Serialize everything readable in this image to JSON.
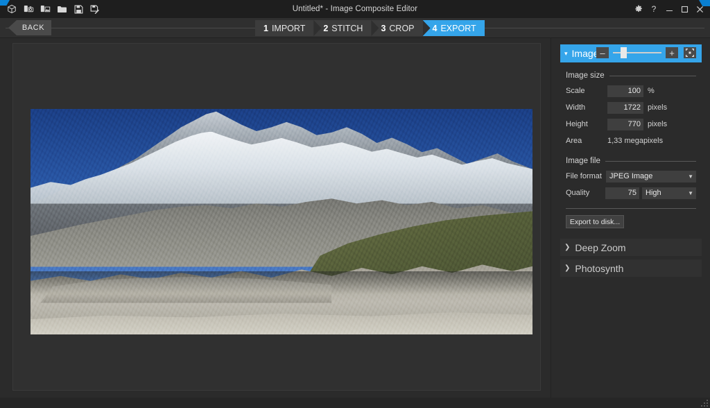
{
  "window": {
    "title": "Untitled* - Image Composite Editor",
    "toolbar_icons": [
      {
        "name": "app-cube-icon",
        "label": "Image Composite Editor"
      },
      {
        "name": "new-panorama-from-camera-icon",
        "label": "New panorama from camera"
      },
      {
        "name": "new-panorama-from-images-icon",
        "label": "New panorama from images"
      },
      {
        "name": "open-folder-icon",
        "label": "Open"
      },
      {
        "name": "save-icon",
        "label": "Save"
      },
      {
        "name": "save-as-icon",
        "label": "Save as"
      }
    ],
    "controls": [
      {
        "name": "settings-gear-icon",
        "label": "Settings"
      },
      {
        "name": "help-icon",
        "label": "Help"
      },
      {
        "name": "minimize-icon",
        "label": "Minimize"
      },
      {
        "name": "maximize-icon",
        "label": "Maximize"
      },
      {
        "name": "close-icon",
        "label": "Close"
      }
    ]
  },
  "stepbar": {
    "back_label": "BACK",
    "steps": [
      {
        "num": "1",
        "label": "IMPORT",
        "active": false
      },
      {
        "num": "2",
        "label": "STITCH",
        "active": false
      },
      {
        "num": "3",
        "label": "CROP",
        "active": false
      },
      {
        "num": "4",
        "label": "EXPORT",
        "active": true
      }
    ],
    "active_color": "#35a5ea"
  },
  "zoom_toolbar": {
    "zoom_out_label": "–",
    "zoom_in_label": "+",
    "fit_label": "Fit to window",
    "slider_position_pct": 16
  },
  "preview": {
    "name": "stitched-panorama-preview",
    "description": "Stitched panorama of a snow-capped mountain range above a rocky glacial moraine under deep blue sky"
  },
  "panel": {
    "image_section": {
      "title": "Image",
      "expanded": true,
      "chevron": "▾",
      "image_size": {
        "group_title": "Image size",
        "rows": [
          {
            "label": "Scale",
            "value": "100",
            "unit": "%",
            "editable": true
          },
          {
            "label": "Width",
            "value": "1722",
            "unit": "pixels",
            "editable": true
          },
          {
            "label": "Height",
            "value": "770",
            "unit": "pixels",
            "editable": true
          }
        ],
        "area_label": "Area",
        "area_value": "1,33 megapixels"
      },
      "image_file": {
        "group_title": "Image file",
        "file_format_label": "File format",
        "file_format_value": "JPEG Image",
        "quality_label": "Quality",
        "quality_value": "75",
        "quality_preset": "High"
      },
      "export_button_label": "Export to disk..."
    },
    "collapsed_sections": [
      {
        "title": "Deep Zoom",
        "chevron": "❯"
      },
      {
        "title": "Photosynth",
        "chevron": "❯"
      }
    ]
  },
  "statusbar": {
    "text": "",
    "grip_name": "resize-grip"
  }
}
